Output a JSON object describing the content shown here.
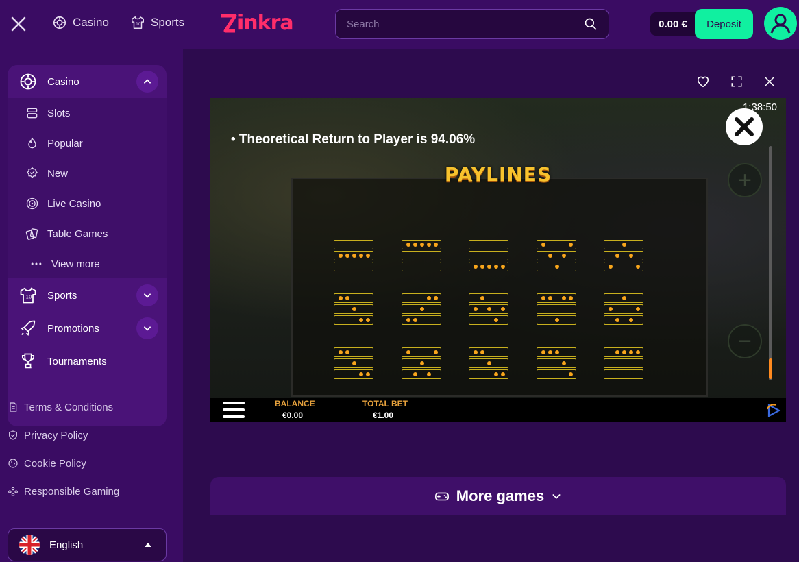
{
  "header": {
    "casino_label": "Casino",
    "sports_label": "Sports",
    "logo_text": "inkra",
    "search_placeholder": "Search",
    "balance": "0.00 €",
    "deposit_label": "Deposit"
  },
  "sidebar": {
    "casino_label": "Casino",
    "sub_items": [
      "Slots",
      "Popular",
      "New",
      "Live Casino",
      "Table Games",
      "View more"
    ],
    "sports_label": "Sports",
    "promotions_label": "Promotions",
    "tournaments_label": "Tournaments",
    "footer_links": [
      "Terms & Conditions",
      "Privacy Policy",
      "Cookie Policy",
      "Responsible Gaming"
    ],
    "language": "English"
  },
  "game": {
    "clock": "1:38:50",
    "rtp_text": "• Theoretical Return to Player is 94.06%",
    "paylines_title": "PAYLINES",
    "balance_label": "BALANCE",
    "balance_value": "€0.00",
    "total_bet_label": "TOTAL BET",
    "total_bet_value": "€1.00",
    "paylines": [
      [
        [],
        [
          0,
          1,
          2,
          3,
          4
        ],
        []
      ],
      [
        [
          0,
          1,
          2,
          3,
          4
        ],
        [],
        []
      ],
      [
        [],
        [],
        [
          0,
          1,
          2,
          3,
          4
        ]
      ],
      [
        [
          0,
          4
        ],
        [
          1,
          3
        ],
        [
          2
        ]
      ],
      [
        [
          2
        ],
        [
          1,
          3
        ],
        [
          0,
          4
        ]
      ],
      [
        [
          0,
          1
        ],
        [
          2
        ],
        [
          3,
          4
        ]
      ],
      [
        [
          3,
          4
        ],
        [
          2
        ],
        [
          0,
          1
        ]
      ],
      [
        [
          1
        ],
        [
          0,
          2,
          4
        ],
        [
          3
        ]
      ],
      [
        [
          0,
          1,
          3,
          4
        ],
        [],
        [
          2
        ]
      ],
      [
        [
          2
        ],
        [
          0,
          4
        ],
        [
          1,
          3
        ]
      ],
      [
        [
          0,
          1
        ],
        [
          2
        ],
        [
          3,
          4
        ]
      ],
      [
        [
          0,
          4
        ],
        [
          2
        ],
        [
          1,
          3
        ]
      ],
      [
        [
          0,
          1
        ],
        [
          2
        ],
        [
          3,
          4
        ]
      ],
      [
        [
          0,
          1,
          2
        ],
        [
          3
        ],
        [
          4
        ]
      ],
      [
        [
          1,
          2,
          3,
          4
        ],
        [],
        []
      ]
    ]
  },
  "more_games_label": "More games"
}
